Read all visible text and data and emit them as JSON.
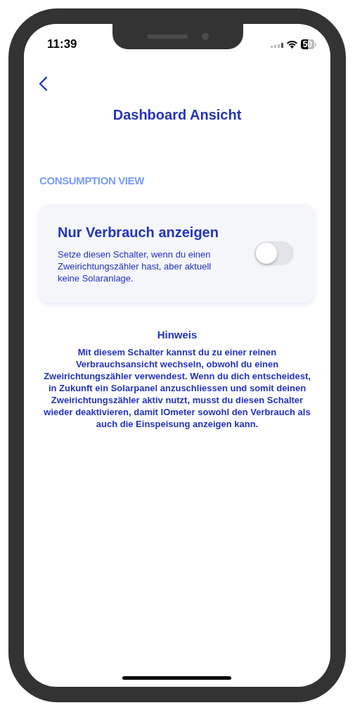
{
  "status_bar": {
    "time": "11:39",
    "battery": "50"
  },
  "header": {
    "title": "Dashboard Ansicht"
  },
  "section": {
    "heading": "CONSUMPTION VIEW"
  },
  "setting": {
    "title": "Nur Verbrauch anzeigen",
    "description": "Setze diesen Schalter, wenn du einen Zweirichtungszähler hast, aber aktuell keine Solaranlage.",
    "on": false
  },
  "note": {
    "title": "Hinweis",
    "text": "Mit diesem Schalter kannst du zu einer reinen Verbrauchsansicht wechseln, obwohl du einen Zweirichtungszähler verwendest. Wenn du dich entscheidest, in Zukunft ein Solarpanel anzuschliessen und somit deinen Zweirichtungszähler aktiv nutzt, musst du diesen Schalter wieder deaktivieren, damit IOmeter sowohl den Verbrauch als auch die Einspeisung anzeigen kann."
  }
}
